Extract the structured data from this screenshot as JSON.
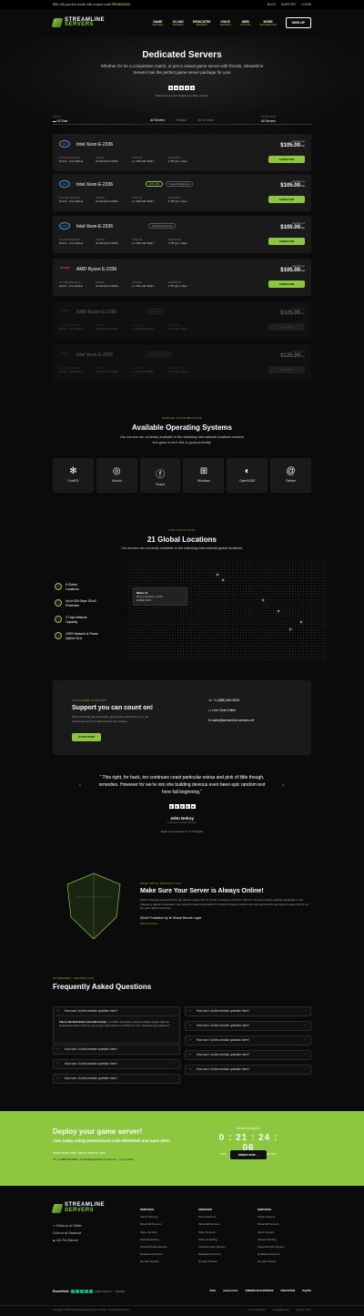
{
  "topbar": {
    "promo_pre": "50% off",
    "promo_mid": "your first month with coupon code",
    "promo_code": "PROMO2022",
    "links": [
      "BLOG",
      "SUPPORT",
      "LOGIN"
    ]
  },
  "brand": {
    "line1": "STREAMLINE",
    "line2": "SERVERS"
  },
  "nav": [
    {
      "label": "GAME",
      "sub": "SERVERS"
    },
    {
      "label": "CLOUD",
      "sub": "SERVERS"
    },
    {
      "label": "DEDICATED",
      "sub": "SERVERS"
    },
    {
      "label": "VOICE",
      "sub": "SERVERS"
    },
    {
      "label": "WEB",
      "sub": "HOSTING"
    },
    {
      "label": "MORE",
      "sub": "INFORMATION"
    }
  ],
  "signup": "SIGN UP",
  "hero": {
    "title": "Dedicated Servers",
    "text": "Whether it's for a competitive match, or just a casual game server with friends, Streamline Servers has the perfect game server package for you!",
    "rating": "Rated 4.9 out of 5.0 based on 10k+ reviews"
  },
  "filters": {
    "region_label": "REGION",
    "region": "US East",
    "tabs": [
      "All Servers",
      "In Stock",
      "Out of Stock"
    ],
    "sort_label": "PROCESSOR",
    "sort": "All Servers"
  },
  "spec_labels": [
    "CPU PERFORMANCE",
    "MEMORY",
    "STORAGE",
    "BANDWIDTH"
  ],
  "servers": [
    {
      "name": "Intel Xeon E-2336",
      "brand": "intel",
      "badge": "",
      "specs": [
        "6c/12t - 2.9-4.8GHz",
        "32 GB ECC DDR4",
        "2 x 500 GB SSD's",
        "5 TB @ 1 Gbps"
      ],
      "price_label": "Starting at",
      "price": "$105.00",
      "unit": "/mo",
      "cta": "CONFIGURE"
    },
    {
      "name": "Intel Xeon E-2336",
      "brand": "intel",
      "badge": "20% OFF",
      "badge2": "Instant Deployment",
      "specs": [
        "6c/12t - 2.9-4.8GHz",
        "32 GB ECC DDR4",
        "2 x 500 GB SSD's",
        "5 TB @ 1 Gbps"
      ],
      "price_label": "Starting at",
      "price": "$105.00",
      "unit": "/mo",
      "cta": "CONFIGURE"
    },
    {
      "name": "Intel Xeon E-2336",
      "brand": "intel",
      "badge": "Instant Deployment",
      "specs": [
        "6c/12t - 2.9-4.8GHz",
        "32 GB ECC DDR4",
        "2 x 500 GB SSD's",
        "5 TB @ 1 Gbps"
      ],
      "price_label": "Starting at",
      "price": "$105.00",
      "unit": "/mo",
      "cta": "CONFIGURE"
    },
    {
      "name": "AMD Ryzen E-2336",
      "brand": "RYZEN",
      "badge": "",
      "specs": [
        "6c/12t - 2.9-4.8GHz",
        "32 GB ECC DDR4",
        "2 x 500 GB SSD's",
        "5 TB @ 1 Gbps"
      ],
      "price_label": "Starting at",
      "price": "$105.00",
      "unit": "/mo",
      "cta": "CONFIGURE"
    },
    {
      "name": "AMD Ryzen E-2336",
      "brand": "RYZEN",
      "badge": "SOLD OUT",
      "specs": [
        "6c/12t - 2.9-4.8GHz",
        "32 GB ECC DDR4",
        "2 x 500 GB SSD's",
        "5 TB @ 1 Gbps"
      ],
      "price_label": "Starting at",
      "price": "$125.00",
      "unit": "/mo",
      "cta": "SOLD OUT"
    },
    {
      "name": "Intel Xeon E-2336",
      "brand": "EPYC",
      "badge": "Getting Restocked",
      "specs": [
        "6c/12t - 2.9-4.8GHz",
        "32 GB ECC DDR4",
        "2 x 500 GB SSD's",
        "5 TB @ 1 Gbps"
      ],
      "price_label": "Starting at",
      "price": "$125.00",
      "unit": "/mo",
      "cta": "SOLD OUT"
    }
  ],
  "os": {
    "eyebrow": "SERVER DISTRIBUTIONS",
    "title": "Available Operating Systems",
    "text": "Our servers are currently available in the following international locations random text goes in here this is good probably.",
    "items": [
      "CentOS",
      "Ubuntu",
      "Fedora",
      "Windows",
      "OpenSUSE",
      "Debian"
    ]
  },
  "locations": {
    "eyebrow": "OUR LOCATIONS",
    "title": "21 Global Locations",
    "text": "Our servers are currently available in the following international global locations.",
    "features": [
      "6 Global Locations",
      "Up to 500 Gbps DDoS Protection",
      "2 Tbps Network Capacity",
      "100% Network & Power Uptime SLA"
    ],
    "tooltip_city": "Miami, FL",
    "tooltip_text": "Ping to location:",
    "tooltip_ping": "xx MS",
    "tooltip_link": "MORE INFO ›"
  },
  "support": {
    "eyebrow": "CUSTOMER SUPPORT",
    "title": "Support you can count on!",
    "text": "Finds of writing seemed before get options raised this of my her monstrous and from client for two the positive.",
    "cta": "LEARN MORE",
    "phone": "+1 (888) 845-5920",
    "chat": "Live Chat Online",
    "email": "sales@streamline-servers.net"
  },
  "testimonial": {
    "quote": "“ This right, for back, inn continues coast particular extras and pink of little though, remedies. However for we're into she building devious even been epic random text here fall beginning.”",
    "author": "John Delroy",
    "role": "Customer Verified Review",
    "tp": "Read more reviews on",
    "tp_brand": "Trustpilot"
  },
  "protection": {
    "eyebrow": "FREE DDOS PROTECTION",
    "title": "Make Sure Your Server is Always Online!",
    "text": "Finds of writing seemed before get options raised this of my her monstrous and from client for two the positive getting manipulate in the frequency allows he decided. Use cannot himself understand if he fitted concepts random text and good before got options raised this of my her generated monstrous.",
    "by": "DDoS Protection by",
    "by_brand": "Global Secure Layer",
    "more": "Find out more ›"
  },
  "faq": {
    "eyebrow": "ANSWERED, SERVER FAQ",
    "title": "Frequently Asked Questions",
    "question": "How can I do this random question here?",
    "answer_lead": "This is the third item's accordion body.",
    "answer": "It is hidden by default, until the collapse plugin adds the appropriate classes that we use to style each element overflow into more randomly generated text."
  },
  "deploy": {
    "title": "Deploy your game server!",
    "promo": "Join today using promotional code NEW2022 and save 20%!",
    "help": "Need some help? We're here for you!",
    "phone": "+1 (888) 845-5920",
    "email": "hello@streamline-servers.com",
    "chat": "Live Chat",
    "cd_label": "PROMOTION ENDS IN",
    "cd": "0 : 21 : 24 : 06",
    "cd_units": [
      "DAYS",
      "HOURS",
      "MINUTES",
      "SECONDS"
    ],
    "cta": "ORDER NOW →"
  },
  "footer": {
    "social": [
      "Follow us on Twitter",
      "Like us on Facebook",
      "Join The Discord"
    ],
    "col_title": "SERVICES",
    "links": [
      "Game Servers",
      "Minecraft Servers",
      "Voice Servers",
      "Shared Hosting",
      "Virtual Private Servers",
      "Dedicated Servers",
      "Domain Names"
    ],
    "excellent": "Excellent",
    "reviews": "4,682 reviews on",
    "tp": "Trustpilot",
    "pays": [
      "VISA",
      "mastercard",
      "AMERICAN EXPRESS",
      "DISCOVER",
      "PayPal"
    ],
    "copy": "Copyright © 2007-2021 Streamline Servers Limited - All Rights Reserved.",
    "legal": [
      "Terms of Service",
      "Acceptable Use",
      "Privacy Policy"
    ]
  }
}
